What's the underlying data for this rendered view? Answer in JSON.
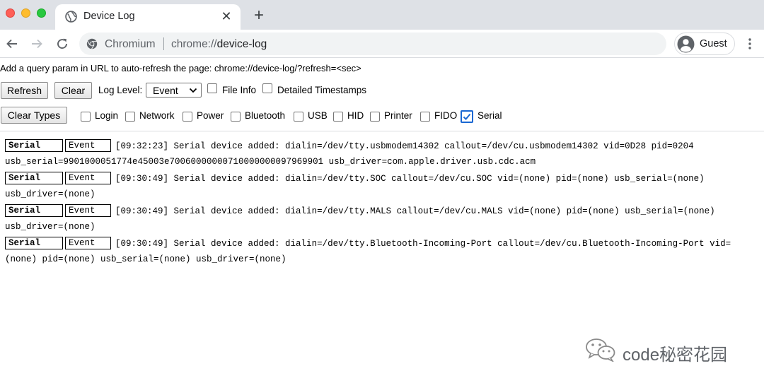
{
  "browser": {
    "tab_title": "Device Log",
    "new_tab_symbol": "+",
    "close_symbol": "✕",
    "site_name": "Chromium",
    "url_scheme": "chrome://",
    "url_host": "device-log",
    "profile_label": "Guest",
    "icons": {
      "tab": "globe-icon",
      "site": "chromium-icon",
      "profile": "avatar-icon",
      "menu": "more-vertical-icon"
    }
  },
  "page": {
    "hint": "Add a query param in URL to auto-refresh the page: chrome://device-log/?refresh=<sec>",
    "refresh_label": "Refresh",
    "clear_label": "Clear",
    "log_level_label": "Log Level:",
    "log_level_value": "Event",
    "file_info_label": "File Info",
    "file_info_checked": false,
    "detailed_timestamps_label": "Detailed Timestamps",
    "detailed_timestamps_checked": false,
    "clear_types_label": "Clear Types",
    "types": [
      {
        "label": "Login",
        "checked": false
      },
      {
        "label": "Network",
        "checked": false
      },
      {
        "label": "Power",
        "checked": false
      },
      {
        "label": "Bluetooth",
        "checked": false
      },
      {
        "label": "USB",
        "checked": false
      },
      {
        "label": "HID",
        "checked": false
      },
      {
        "label": "Printer",
        "checked": false
      },
      {
        "label": "FIDO",
        "checked": false
      },
      {
        "label": "Serial",
        "checked": true
      }
    ]
  },
  "log_entries": [
    {
      "type": "Serial",
      "level": "Event",
      "timestamp": "[09:32:23]",
      "message": "Serial device added: dialin=/dev/tty.usbmodem14302 callout=/dev/cu.usbmodem14302 vid=0D28 pid=0204 usb_serial=9901000051774e45003e70060000000710000000097969901 usb_driver=com.apple.driver.usb.cdc.acm"
    },
    {
      "type": "Serial",
      "level": "Event",
      "timestamp": "[09:30:49]",
      "message": "Serial device added: dialin=/dev/tty.SOC callout=/dev/cu.SOC vid=(none) pid=(none) usb_serial=(none) usb_driver=(none)"
    },
    {
      "type": "Serial",
      "level": "Event",
      "timestamp": "[09:30:49]",
      "message": "Serial device added: dialin=/dev/tty.MALS callout=/dev/cu.MALS vid=(none) pid=(none) usb_serial=(none) usb_driver=(none)"
    },
    {
      "type": "Serial",
      "level": "Event",
      "timestamp": "[09:30:49]",
      "message": "Serial device added: dialin=/dev/tty.Bluetooth-Incoming-Port callout=/dev/cu.Bluetooth-Incoming-Port vid=(none) pid=(none) usb_serial=(none) usb_driver=(none)"
    }
  ],
  "watermark": {
    "text": "code秘密花园",
    "icon": "wechat-icon"
  }
}
